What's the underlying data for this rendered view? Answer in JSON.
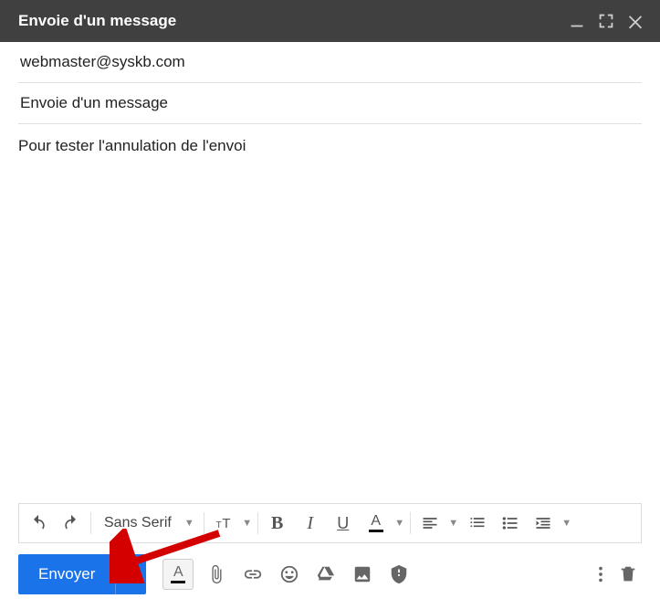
{
  "header": {
    "title": "Envoie d'un message"
  },
  "compose": {
    "to": "webmaster@syskb.com",
    "subject": "Envoie d'un message",
    "body": "Pour tester l'annulation de l'envoi"
  },
  "formatting": {
    "font_family": "Sans Serif",
    "bold_glyph": "B",
    "italic_glyph": "I",
    "underline_glyph": "U",
    "textcolor_glyph": "A"
  },
  "actions": {
    "send_label": "Envoyer",
    "format_glyph": "A"
  },
  "icons": {
    "minimize": "minimize",
    "fullscreen": "fullscreen",
    "close": "close"
  }
}
